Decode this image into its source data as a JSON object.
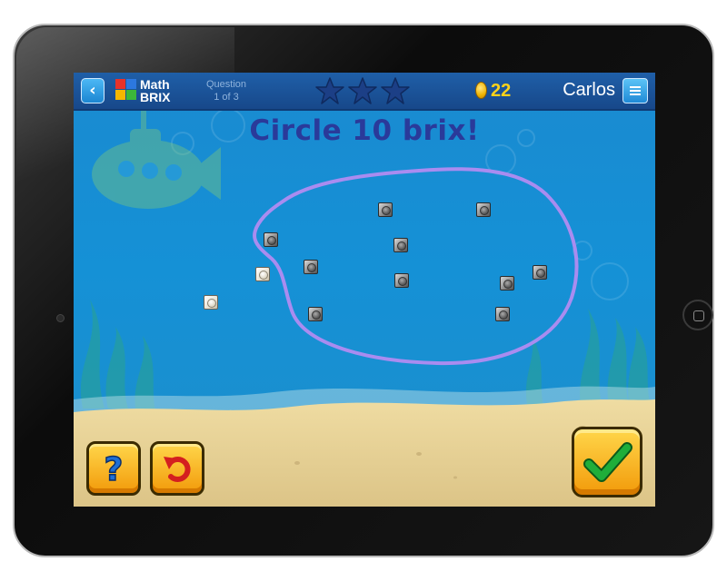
{
  "topbar": {
    "logo_line1": "Math",
    "logo_line2": "BRIX",
    "question_label": "Question",
    "question_progress": "1 of 3",
    "stars_earned": 0,
    "stars_total": 3,
    "coin_count": "22",
    "username": "Carlos"
  },
  "game": {
    "prompt": "Circle 10 brix!",
    "circled_count": 10,
    "bricks": [
      {
        "kind": "gray"
      },
      {
        "kind": "gray"
      },
      {
        "kind": "gray"
      },
      {
        "kind": "gray"
      },
      {
        "kind": "gray"
      },
      {
        "kind": "gray"
      },
      {
        "kind": "gray"
      },
      {
        "kind": "gray"
      },
      {
        "kind": "gray"
      },
      {
        "kind": "gray"
      },
      {
        "kind": "light"
      },
      {
        "kind": "light"
      }
    ]
  },
  "icons": {
    "back": "back-arrow-icon",
    "menu": "hamburger-menu-icon",
    "star": "star-icon",
    "coin": "coin-icon",
    "help": "question-mark-icon",
    "undo": "undo-arrow-icon",
    "submit": "checkmark-icon"
  },
  "colors": {
    "topbar": "#1f5fa8",
    "water": "#1591d6",
    "sand": "#e8d59a",
    "lasso": "#a98cf0",
    "prompt": "#2a3a9a",
    "coin_text": "#ffd21a",
    "button_yellow": "#ffd64a",
    "check_green": "#1fae3a",
    "undo_red": "#d41f1f",
    "help_blue": "#1f6fd6"
  }
}
